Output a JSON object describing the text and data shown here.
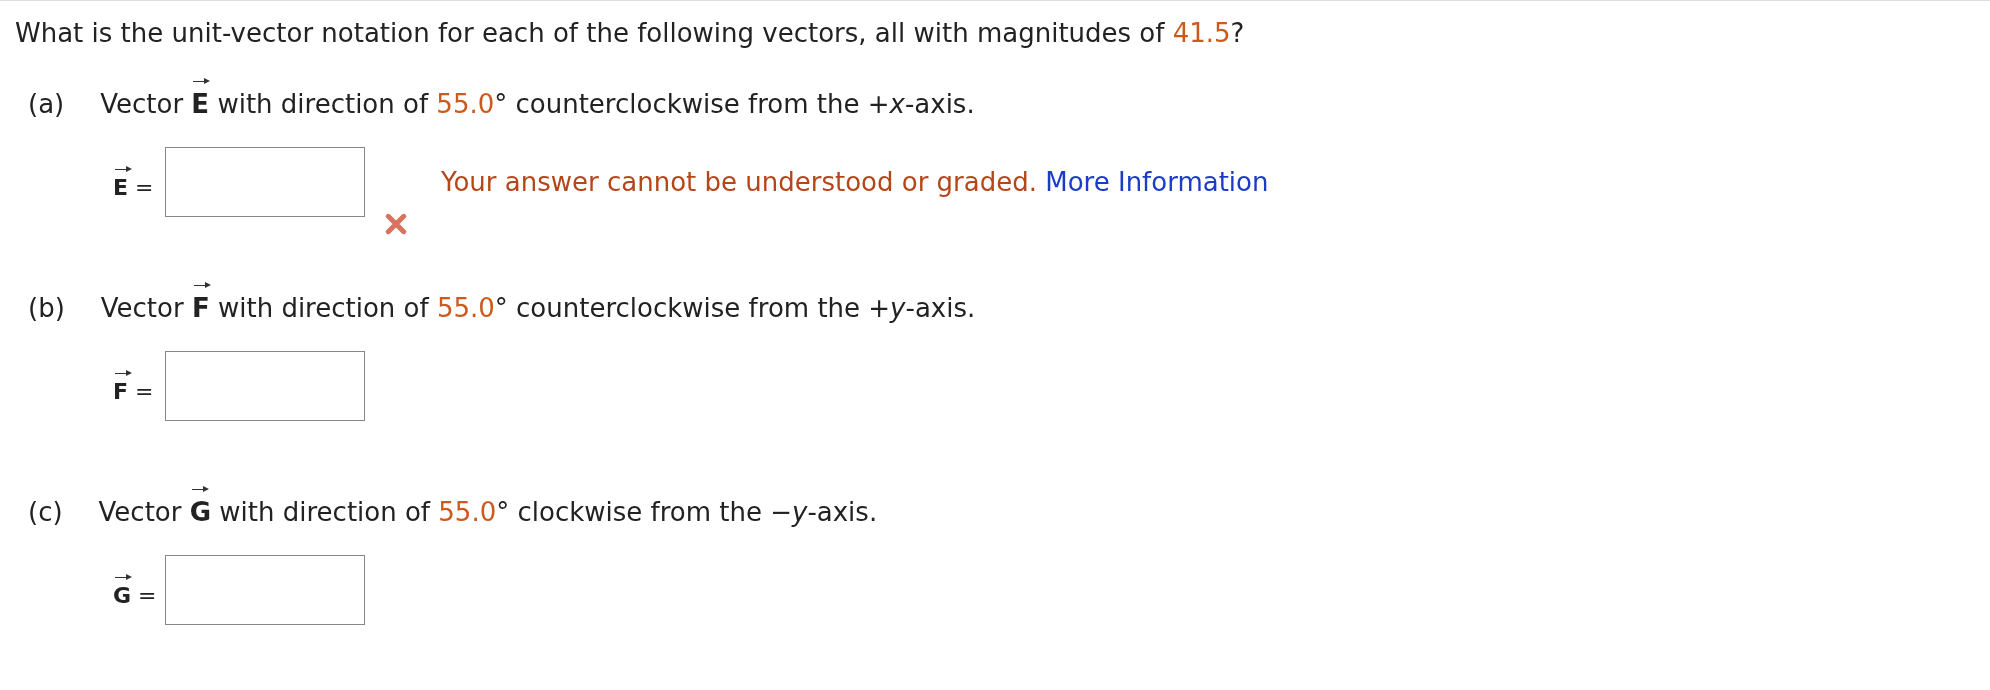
{
  "question": {
    "before": "What is the unit-vector notation for each of the following vectors, all with magnitudes of ",
    "value": "41.5",
    "after": "?"
  },
  "parts": [
    {
      "label": "(a)",
      "before": "Vector",
      "symbol": "E",
      "middle": "with direction of",
      "value": "55.0",
      "after": "° counterclockwise from the +*x*-axis.",
      "answer": {
        "symbol": "E",
        "equals": "=",
        "incorrect": true,
        "feedback": {
          "message": "Your answer cannot be understood or graded.",
          "link": "More Information"
        }
      }
    },
    {
      "label": "(b)",
      "before": "Vector",
      "symbol": "F",
      "middle": "with direction of",
      "value": "55.0",
      "after": "° counterclockwise from the +*y*-axis.",
      "answer": {
        "symbol": "F",
        "equals": "=",
        "incorrect": false
      }
    },
    {
      "label": "(c)",
      "before": "Vector",
      "symbol": "G",
      "middle": "with direction of",
      "value": "55.0",
      "after": "° clockwise from the −*y*-axis.",
      "answer": {
        "symbol": "G",
        "equals": "=",
        "incorrect": false
      }
    }
  ]
}
